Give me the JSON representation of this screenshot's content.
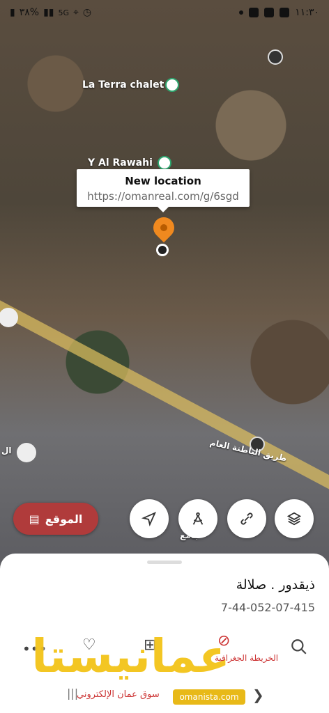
{
  "status": {
    "battery": "٣٨%",
    "network": "5G",
    "time": "١١:٣٠"
  },
  "map": {
    "poi_labels": [
      "La Terra chalet",
      "Y Al Rawahi"
    ],
    "road_label": "طريق الباطنة العام",
    "popup": {
      "title": "New location",
      "url": "https://omanreal.com/g/6sgd"
    },
    "left_label": "ال",
    "mosque_label": "جامع"
  },
  "actions": {
    "location_button": "الموقع"
  },
  "sheet": {
    "address": "ذيقدور . صلالة",
    "code": "7-44-052-07-415"
  },
  "watermark": {
    "logo_text": "عمانيستا",
    "url": "omanista.com",
    "tagline": "سوق عمان الإلكتروني",
    "map_label": "الخريطة الجغرافية"
  },
  "colors": {
    "accent_red": "#b03b3b",
    "pin_orange": "#f0891f",
    "poi_green": "#2ea66f",
    "watermark_yellow": "#f3c318"
  }
}
